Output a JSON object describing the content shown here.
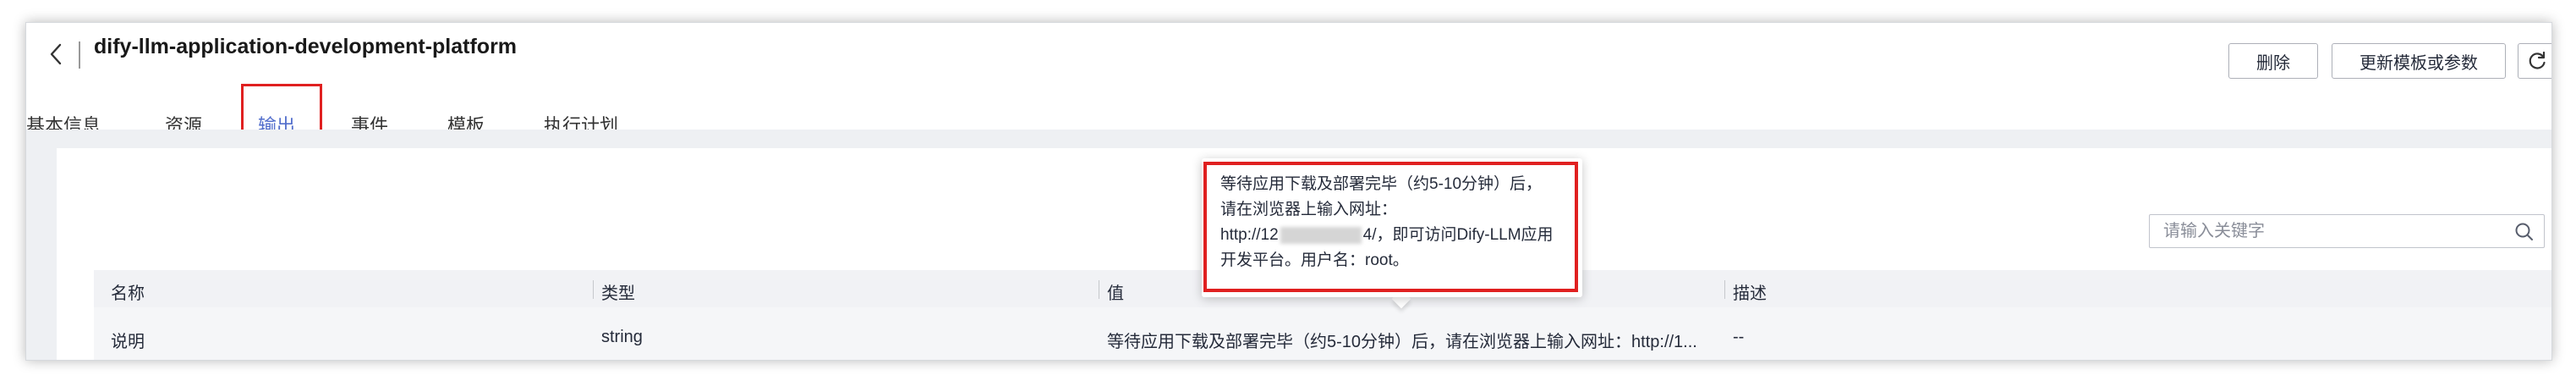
{
  "header": {
    "title": "dify-llm-application-development-platform",
    "back_icon": "chevron-left-icon",
    "actions": {
      "delete_label": "删除",
      "update_label": "更新模板或参数",
      "refresh_icon": "refresh-icon"
    }
  },
  "tabs": [
    {
      "label": "基本信息",
      "active": false
    },
    {
      "label": "资源",
      "active": false
    },
    {
      "label": "输出",
      "active": true
    },
    {
      "label": "事件",
      "active": false
    },
    {
      "label": "模板",
      "active": false
    },
    {
      "label": "执行计划",
      "active": false
    }
  ],
  "search": {
    "placeholder": "请输入关键字",
    "value": "",
    "icon": "search-icon"
  },
  "table": {
    "columns": [
      "名称",
      "类型",
      "值",
      "描述"
    ],
    "rows": [
      {
        "name": "说明",
        "type": "string",
        "value": "等待应用下载及部署完毕（约5-10分钟）后，请在浏览器上输入网址：http://1...",
        "description": "--"
      }
    ]
  },
  "tooltip": {
    "lines": [
      "等待应用下载及部署完毕（约5-10分钟）后，",
      "请在浏览器上输入网址：",
      "http://12",
      "4/，即可访问Dify-LLM应用",
      "开发平台。用户名：root。"
    ]
  },
  "colors": {
    "accent": "#526ecc",
    "highlight": "#e02020",
    "content_bg": "#eef0f3",
    "table_header_bg": "#f1f2f5"
  }
}
